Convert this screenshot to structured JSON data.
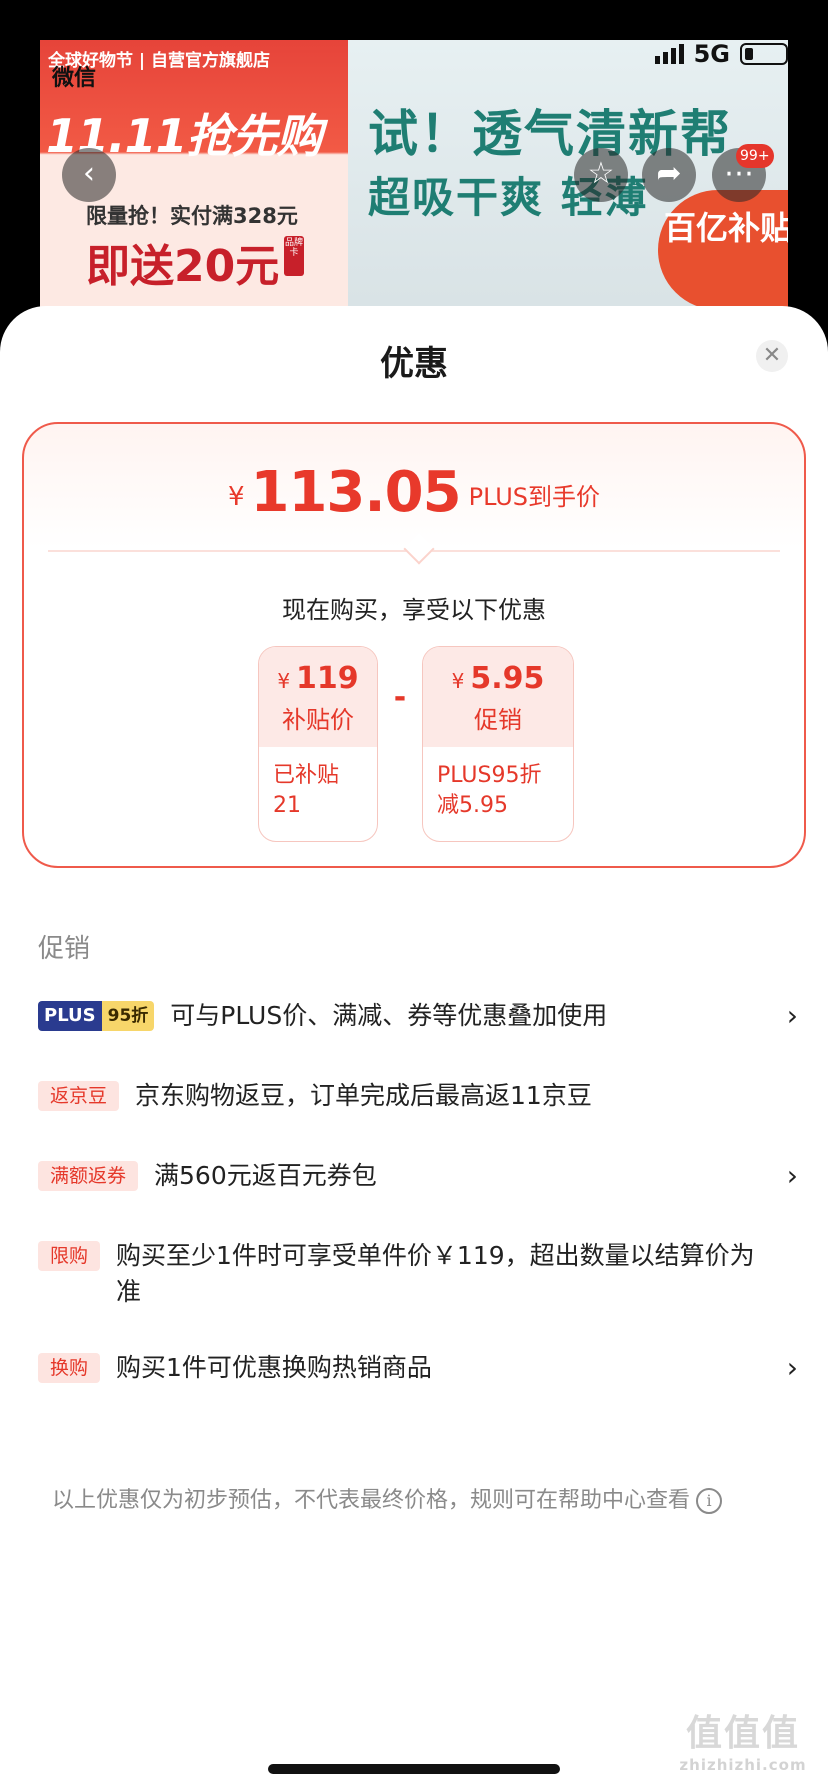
{
  "status_bar": {
    "app_label": "微信",
    "network": "5G"
  },
  "banner": {
    "store": "全球好物节 | 自营官方旗舰店",
    "event": "11.11抢先购",
    "limited": "限量抢！实付满328元",
    "gift": "即送20元",
    "gift_tag": "品牌卡",
    "headline1": "试！透气清新帮",
    "headline2": "超吸干爽 轻薄",
    "subsidy": "百亿补贴",
    "cart_badge": "99+"
  },
  "sheet": {
    "title": "优惠",
    "final_price": {
      "currency": "¥",
      "amount": "113.05",
      "label": "PLUS到手价"
    },
    "enjoy_text": "现在购买，享受以下优惠",
    "coupons": [
      {
        "currency": "¥",
        "amount": "119",
        "kind": "补贴价",
        "detail": "已补贴21"
      },
      {
        "currency": "¥",
        "amount": "5.95",
        "kind": "促销",
        "detail": "PLUS95折减5.95"
      }
    ],
    "minus_symbol": "-",
    "promo_header": "促销",
    "promotions": [
      {
        "tag_plus": "PLUS",
        "tag_discount": "95折",
        "text": "可与PLUS价、满减、券等优惠叠加使用",
        "has_arrow": true
      },
      {
        "tag": "返京豆",
        "text": "京东购物返豆，订单完成后最高返11京豆",
        "has_arrow": false
      },
      {
        "tag": "满额返券",
        "text": "满560元返百元券包",
        "has_arrow": true
      },
      {
        "tag": "限购",
        "text": "购买至少1件时可享受单件价￥119，超出数量以结算价为准",
        "has_arrow": false
      },
      {
        "tag": "换购",
        "text": "购买1件可优惠换购热销商品",
        "has_arrow": true
      }
    ],
    "disclaimer": "以上优惠仅为初步预估，不代表最终价格，规则可在帮助中心查看"
  },
  "watermark": {
    "main": "值值值",
    "sub": "zhizhizhi.com"
  },
  "colors": {
    "accent": "#e8392b",
    "tag_bg": "#fde4e0",
    "plus_blue": "#2a3b8f",
    "plus_gold": "#f7d66a"
  }
}
